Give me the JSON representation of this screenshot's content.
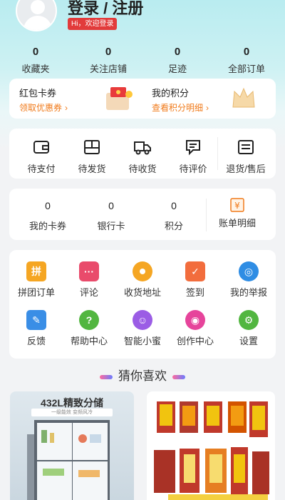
{
  "header": {
    "login_title": "登录 / 注册",
    "welcome_badge": "Hi，欢迎登录"
  },
  "stats": [
    {
      "value": "0",
      "label": "收藏夹"
    },
    {
      "value": "0",
      "label": "关注店铺"
    },
    {
      "value": "0",
      "label": "足迹"
    },
    {
      "value": "0",
      "label": "全部订单"
    }
  ],
  "promo": {
    "coupon_title": "红包卡券",
    "coupon_link": "领取优惠券",
    "points_title": "我的积分",
    "points_link": "查看积分明细"
  },
  "orders": [
    {
      "label": "待支付",
      "icon": "wallet-icon"
    },
    {
      "label": "待发货",
      "icon": "package-icon"
    },
    {
      "label": "待收货",
      "icon": "truck-icon"
    },
    {
      "label": "待评价",
      "icon": "comment-icon"
    },
    {
      "label": "退货/售后",
      "icon": "return-icon"
    }
  ],
  "assets": [
    {
      "value": "0",
      "label": "我的卡券"
    },
    {
      "value": "0",
      "label": "银行卡"
    },
    {
      "value": "0",
      "label": "积分"
    },
    {
      "label": "账单明细",
      "icon": "bill-icon"
    }
  ],
  "services": [
    {
      "label": "拼团订单",
      "icon": "group-order-icon",
      "color": "#f5a623"
    },
    {
      "label": "评论",
      "icon": "chat-icon",
      "color": "#e94b6b"
    },
    {
      "label": "收货地址",
      "icon": "location-icon",
      "color": "#f5a623"
    },
    {
      "label": "签到",
      "icon": "calendar-icon",
      "color": "#f26d3d"
    },
    {
      "label": "我的举报",
      "icon": "target-icon",
      "color": "#2f8de4"
    },
    {
      "label": "反馈",
      "icon": "feedback-icon",
      "color": "#3a8ee6"
    },
    {
      "label": "帮助中心",
      "icon": "help-icon",
      "color": "#52b640"
    },
    {
      "label": "智能小蜜",
      "icon": "assistant-icon",
      "color": "#9b5de5"
    },
    {
      "label": "创作中心",
      "icon": "camera-icon",
      "color": "#e6449b"
    },
    {
      "label": "设置",
      "icon": "gear-icon",
      "color": "#52b640"
    }
  ],
  "guess_title": "猜你喜欢",
  "products": [
    {
      "title": "432L精致分储",
      "subtitle": "一级能效 变频风冷"
    }
  ]
}
